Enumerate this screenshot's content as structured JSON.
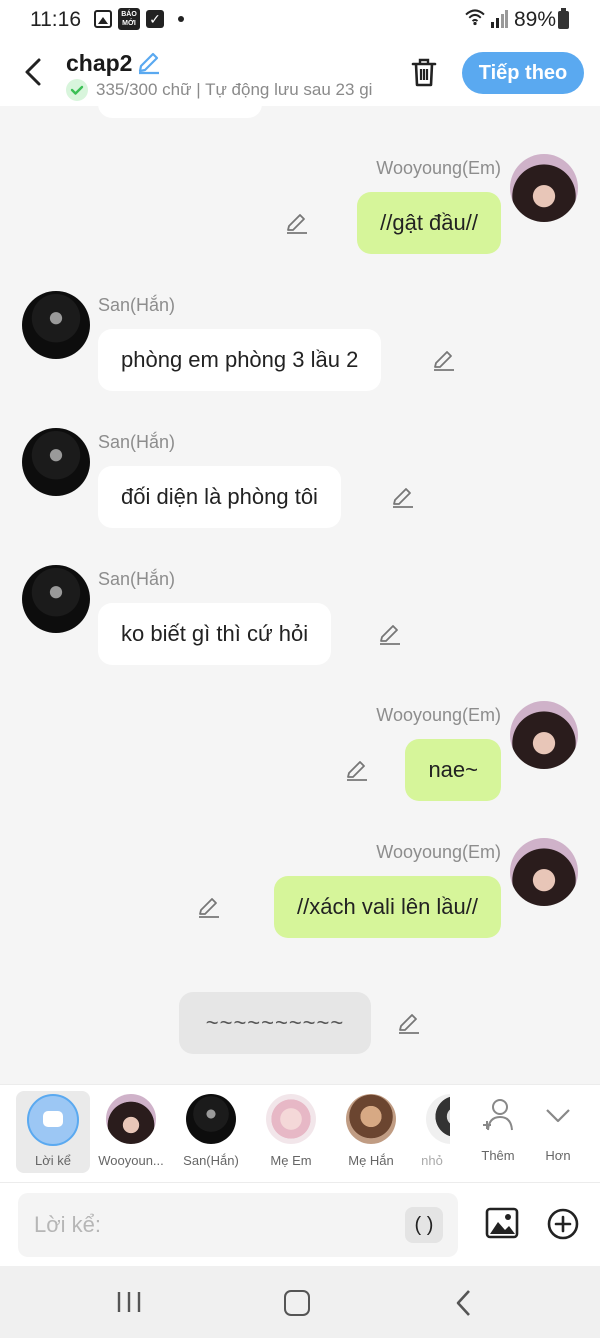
{
  "status_bar": {
    "time": "11:16",
    "baomoi_label": "BÁO MỚI",
    "battery": "89%"
  },
  "header": {
    "title": "chap2",
    "subtitle": "335/300 chữ | Tự động lưu sau 23 gi",
    "next_label": "Tiếp theo"
  },
  "messages": [
    {
      "side": "right",
      "sender": "Wooyoung(Em)",
      "text": "//gật đầu//"
    },
    {
      "side": "left",
      "sender": "San(Hắn)",
      "text": "phòng em phòng 3 lầu 2"
    },
    {
      "side": "left",
      "sender": "San(Hắn)",
      "text": "đối diện là phòng tôi"
    },
    {
      "side": "left",
      "sender": "San(Hắn)",
      "text": "ko biết gì thì cứ hỏi"
    },
    {
      "side": "right",
      "sender": "Wooyoung(Em)",
      "text": "nae~"
    },
    {
      "side": "right",
      "sender": "Wooyoung(Em)",
      "text": "//xách vali lên lầu//"
    },
    {
      "side": "center",
      "sender": "",
      "text": "~~~~~~~~~~"
    }
  ],
  "character_bar": {
    "items": [
      {
        "label": "Lời kể"
      },
      {
        "label": "Wooyoun..."
      },
      {
        "label": "San(Hắn)"
      },
      {
        "label": "Mẹ Em"
      },
      {
        "label": "Mẹ Hắn"
      },
      {
        "label": "nhỏ"
      }
    ],
    "more_label": "Thêm",
    "expand_label": "Hơn"
  },
  "input": {
    "placeholder": "Lời kể:",
    "paren_label": "( )"
  },
  "colors": {
    "accent": "#5aa9f0",
    "user_bubble": "#d6f59a",
    "other_bubble": "#ffffff",
    "narration_bubble": "#e6e6e6",
    "background": "#f5f5f5"
  },
  "icons": [
    "back-arrow-icon",
    "pencil-icon",
    "check-icon",
    "trash-icon",
    "add-person-icon",
    "chevron-down-icon",
    "image-icon",
    "plus-circle-icon"
  ]
}
